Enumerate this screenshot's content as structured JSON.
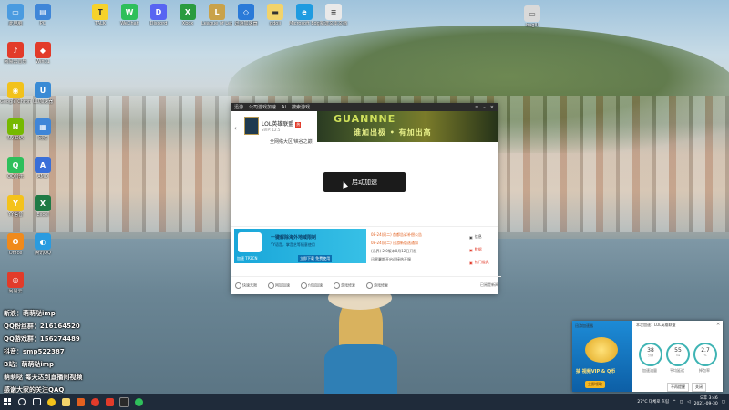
{
  "desktop": {
    "icons": [
      {
        "label": "此电脑",
        "color": "#4a9be0",
        "glyph": "▭"
      },
      {
        "label": "PC",
        "color": "#3f86d8",
        "glyph": "▤"
      },
      {
        "label": "网易云音乐",
        "color": "#e23b2a",
        "glyph": "♪"
      },
      {
        "label": "Win11",
        "color": "#e23b2a",
        "glyph": "◆"
      },
      {
        "label": "Google Chrome",
        "color": "#f2c21b",
        "glyph": "◉"
      },
      {
        "label": "UU加速器",
        "color": "#3a8bd5",
        "glyph": "U"
      },
      {
        "label": "NVIDIA",
        "color": "#76b900",
        "glyph": "N"
      },
      {
        "label": "网络",
        "color": "#3f86d8",
        "glyph": "▦"
      },
      {
        "label": "QQ音乐",
        "color": "#2fbf5b",
        "glyph": "Q"
      },
      {
        "label": "AMD",
        "color": "#3a6fd8",
        "glyph": "A"
      },
      {
        "label": "YY语音",
        "color": "#f4c21b",
        "glyph": "Y"
      },
      {
        "label": "Excel",
        "color": "#1f7a45",
        "glyph": "X"
      },
      {
        "label": "Office",
        "color": "#f08a1c",
        "glyph": "O"
      },
      {
        "label": "腾讯QQ",
        "color": "#2a9be0",
        "glyph": "◐"
      },
      {
        "label": "网易云",
        "color": "#e23b2a",
        "glyph": "◎"
      },
      {
        "label": "TALK",
        "color": "#f6d22b",
        "glyph": "T"
      },
      {
        "label": "WeChat",
        "color": "#2fbf5b",
        "glyph": "W"
      },
      {
        "label": "Discord",
        "color": "#5865f2",
        "glyph": "D"
      },
      {
        "label": "Xbox",
        "color": "#2a9b3f",
        "glyph": "X"
      },
      {
        "label": "League of Legends",
        "color": "#c9a24a",
        "glyph": "L"
      },
      {
        "label": "迅游加速器",
        "color": "#2a7ad8",
        "glyph": "◇"
      },
      {
        "label": "gdoli",
        "color": "#f2d36b",
        "glyph": "▬"
      },
      {
        "label": "Microsoft Edge",
        "color": "#1f9be0",
        "glyph": "e"
      },
      {
        "label": "新建文本文档",
        "color": "#e9e9e9",
        "glyph": "≡"
      },
      {
        "label": "bagIII",
        "color": "#d9d9d9",
        "glyph": "▭"
      }
    ]
  },
  "app_window": {
    "title": "迅游",
    "nav": [
      "公司游戏加速",
      "AI",
      "搜索游戏"
    ],
    "game_name": "LOL英雄联盟",
    "game_sub": "SVIP: 12.5",
    "hot_badge": "热",
    "region": "全网络大区/峡谷之巅",
    "start_button": "启动加速",
    "banner_big": "GUANNNE",
    "banner_slogan": "谁加出极 • 有加出高",
    "ad": {
      "brand": "加速 TP2CN",
      "line1": "一键解除海外地域限制",
      "line2": "YY语音，掌音艺等随意使用",
      "cta": "立即下载 免费使用"
    },
    "news": [
      "08-24(周二) 首都告诉补偿公告",
      "08-24(周二) 迅游新版选通知",
      "(迅界) 2.0版本8月12日开服",
      "迅界暑期开启迎接热开服"
    ],
    "side_buttons": [
      "信息",
      "数据",
      "热门道具"
    ],
    "bottom_items": [
      "快速无限",
      "网加加速",
      "付加加速",
      "游戏修复",
      "游戏修复"
    ],
    "bottom_right": "已阅是新闻"
  },
  "overlay": {
    "lines": [
      "新浪：萌萌哒imp",
      "QQ粉丝群：216164520",
      "QQ游戏群：156274489",
      "抖音：smp522387",
      "B站：萌萌哒imp",
      "萌萌哒 每天达到直播间视频",
      "感谢大家的关注QAQ"
    ]
  },
  "popup": {
    "title": "本次加速：LOL英雄联盟",
    "header_left": "迅游加速器",
    "vip_text": "抽 视频VIP & Q币",
    "vip_btn": "立即领取",
    "gauges": [
      {
        "value": "38",
        "unit": "分钟",
        "label": "加速流量"
      },
      {
        "value": "55",
        "unit": "ms",
        "label": "平均延迟"
      },
      {
        "value": "2.7",
        "unit": "%",
        "label": "掉包率"
      }
    ],
    "buttons": [
      "不再提醒",
      "关闭"
    ]
  },
  "taskbar": {
    "apps": [
      {
        "color": "#5a8fd8"
      },
      {
        "color": "#f4f4f4"
      },
      {
        "color": "#e2601f"
      },
      {
        "color": "#e23b2a"
      },
      {
        "color": "#e23b2a"
      },
      {
        "color": "#2a2a2a"
      },
      {
        "color": "#2fbf5b"
      }
    ],
    "weather": "27°C 대체로 흐림",
    "time": "오후 3:46",
    "date": "2021-09-30"
  }
}
